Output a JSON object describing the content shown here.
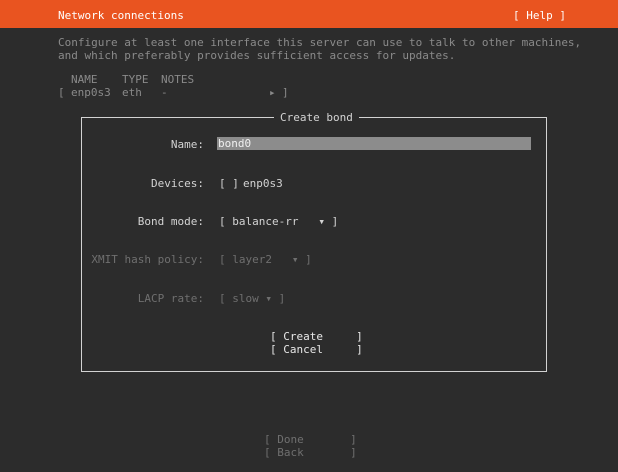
{
  "header": {
    "title": "Network connections",
    "help_label": "[ Help ]"
  },
  "intro": {
    "line1": "Configure at least one interface this server can use to talk to other machines,",
    "line2": "and which preferably provides sufficient access for updates."
  },
  "interfaces_table": {
    "columns": [
      "NAME",
      "TYPE",
      "NOTES"
    ],
    "rows": [
      {
        "bracket_open": "[",
        "name": "enp0s3",
        "type": "eth",
        "notes": "-",
        "arrow": "▸",
        "bracket_close": "]"
      }
    ]
  },
  "dialog": {
    "title": "Create bond",
    "name_label": "Name:",
    "name_value": "bond0",
    "devices_label": "Devices:",
    "devices_checkbox": "[ ]",
    "devices_item": "enp0s3",
    "bond_mode_label": "Bond mode:",
    "bond_mode_value": "[ balance-rr   ▾ ]",
    "xmit_label": "XMIT hash policy:",
    "xmit_value": "[ layer2   ▾ ]",
    "lacp_label": "LACP rate:",
    "lacp_value": "[ slow ▾ ]",
    "create_label": "[ Create     ]",
    "cancel_label": "[ Cancel     ]"
  },
  "footer": {
    "done_label": "[ Done       ]",
    "back_label": "[ Back       ]"
  },
  "colors": {
    "header_bg": "#e95420",
    "background": "#2c2c2c",
    "input_bg": "#8c8c8c"
  }
}
